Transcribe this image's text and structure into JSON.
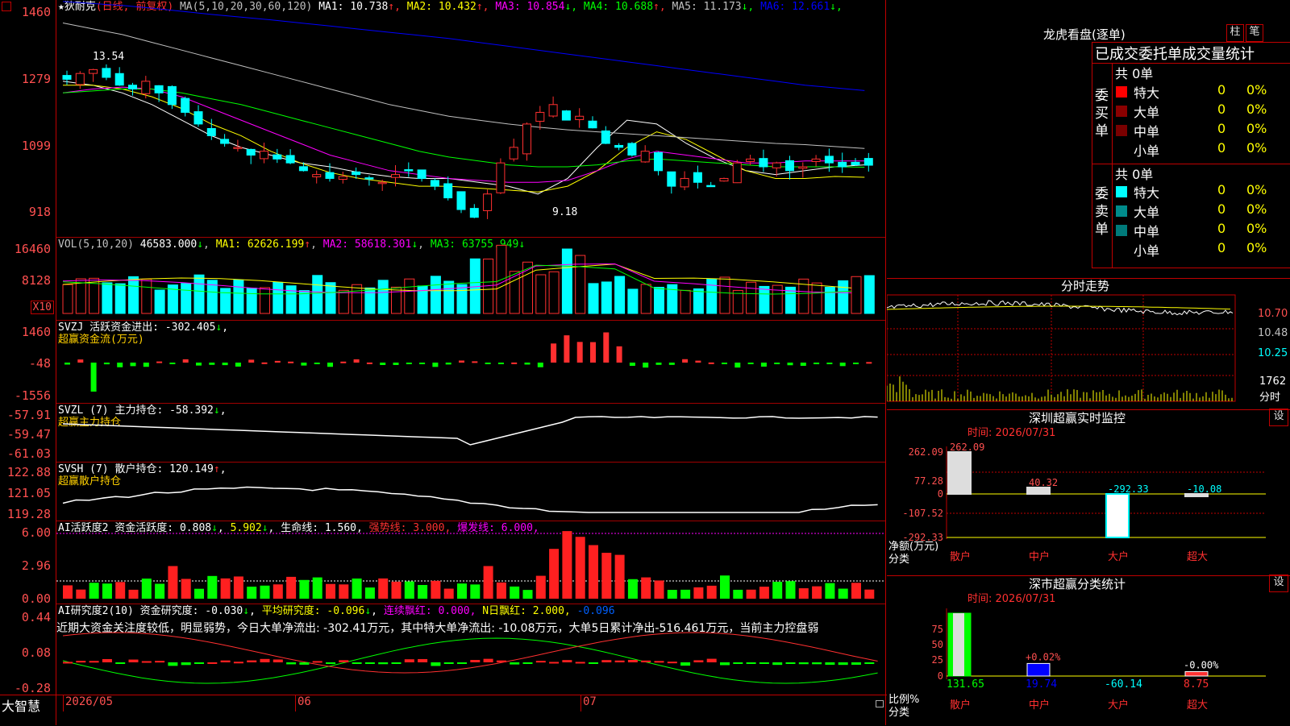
{
  "main": {
    "header_prefix": "★",
    "stock_name": "狄耐克",
    "period_label": "(日线, 前复权)",
    "ma_params": "MA(5,10,20,30,60,120)",
    "ma": [
      {
        "label": "MA1: 10.738",
        "arrow": "↑",
        "color": "#ffffff"
      },
      {
        "label": "MA2: 10.432",
        "arrow": "↑",
        "color": "#ffff00"
      },
      {
        "label": "MA3: 10.854",
        "arrow": "↓",
        "color": "#ff00ff"
      },
      {
        "label": "MA4: 10.688",
        "arrow": "↑",
        "color": "#00ff00"
      },
      {
        "label": "MA5: 11.173",
        "arrow": "↓",
        "color": "#c0c0c0"
      },
      {
        "label": "MA6: 12.661",
        "arrow": "↓",
        "color": "#0000ff"
      }
    ],
    "y_labels": [
      "1460",
      "1279",
      "1099",
      "918"
    ],
    "high_mark": "13.54",
    "low_mark": "9.18"
  },
  "vol": {
    "params": "VOL(5,10,20)",
    "value": "46583.000",
    "ma1": "MA1: 62626.199",
    "ma2": "MA2: 58618.301",
    "ma3": "MA3: 63755.949",
    "y_labels": [
      "16460",
      "8128"
    ],
    "unit": "X10"
  },
  "svzj": {
    "title": "SVZJ  活跃资金进出: -302.405",
    "sub": "超赢资金流(万元)",
    "y_labels": [
      "1460",
      "-48",
      "-1556"
    ]
  },
  "svzl": {
    "title": "SVZL (7) 主力持仓: -58.392",
    "sub": "超赢主力持仓",
    "y_labels": [
      "-57.91",
      "-59.47",
      "-61.03"
    ]
  },
  "svsh": {
    "title": "SVSH (7) 散户持仓: 120.149",
    "sub": "超赢散户持仓",
    "y_labels": [
      "122.88",
      "121.05",
      "119.28"
    ]
  },
  "ai1": {
    "title": "AI活跃度2 资金活跃度: 0.808",
    "v2": "5.902",
    "life": "生命线: 1.560,",
    "strong": "强势线: 3.000,",
    "burst": "爆发线: 6.000,",
    "y_labels": [
      "6.00",
      "2.96",
      "0.00"
    ]
  },
  "ai2": {
    "title": "AI研究度2(10) 资金研究度: -0.030",
    "avg": "平均研究度: -0.096",
    "lianxu": "连续飘红: 0.000,",
    "npiao": "N日飘红: 2.000,",
    "last": "-0.096",
    "comment": "近期大资金关注度较低，明显弱势，今日大单净流出: -302.41万元，其中特大单净流出: -10.08万元，大单5日累计净出-516.461万元，当前主力控盘弱",
    "y_labels": [
      "0.44",
      "0.08",
      "-0.28"
    ]
  },
  "bottom": {
    "brand": "大智慧",
    "dates": [
      "2026/05",
      "06",
      "07"
    ]
  },
  "lhb": {
    "title": "龙虎看盘(逐单)",
    "btn1": "柱",
    "btn2": "笔",
    "heading": "已成交委托单成交量统计",
    "buy_label": "委买单",
    "sell_label": "委卖单",
    "buy_total": "共 0单",
    "sell_total": "共 0单",
    "rows": [
      {
        "name": "特大",
        "count": "0",
        "pct": "0%"
      },
      {
        "name": "大单",
        "count": "0",
        "pct": "0%"
      },
      {
        "name": "中单",
        "count": "0",
        "pct": "0%"
      },
      {
        "name": "小单",
        "count": "0",
        "pct": "0%"
      }
    ],
    "buy_colors": [
      "#ff0000",
      "#8b0000",
      "#7a0000",
      "#000000"
    ],
    "sell_colors": [
      "#00ffff",
      "#008b8b",
      "#007a7a",
      "#000000"
    ]
  },
  "fenshi": {
    "title": "分时走势",
    "y_labels": [
      "10.70",
      "10.48",
      "10.25"
    ],
    "vol_label": "1762",
    "time_label": "分时"
  },
  "monitor": {
    "title": "深圳超赢实时监控",
    "btn": "设",
    "time": "时间: 2026/07/31",
    "y_labels": [
      "262.09",
      "77.28",
      "0",
      "-107.52",
      "-292.33"
    ],
    "bars": [
      {
        "cat": "散户",
        "value": 262.09,
        "label": "262.09"
      },
      {
        "cat": "中户",
        "value": 40.32,
        "label": "40.32"
      },
      {
        "cat": "大户",
        "value": -292.33,
        "label": "-292.33"
      },
      {
        "cat": "超大",
        "value": -10.08,
        "label": "-10.08"
      }
    ],
    "ylabel1": "净额(万元)",
    "ylabel2": "分类"
  },
  "classify": {
    "title": "深市超赢分类统计",
    "btn": "设",
    "time": "时间: 2026/07/31",
    "y_labels": [
      "75",
      "50",
      "25",
      "0"
    ],
    "bars": [
      {
        "cat": "散户",
        "pct": 100,
        "top_label": "",
        "value": "131.65"
      },
      {
        "cat": "中户",
        "pct": 20,
        "top_label": "+0.02%",
        "value": "19.74"
      },
      {
        "cat": "大户",
        "pct": 0,
        "top_label": "",
        "value": "-60.14"
      },
      {
        "cat": "超大",
        "pct": 7,
        "top_label": "-0.00%",
        "value": "8.75"
      }
    ],
    "ylabel1": "比例%",
    "ylabel2": "分类"
  }
}
